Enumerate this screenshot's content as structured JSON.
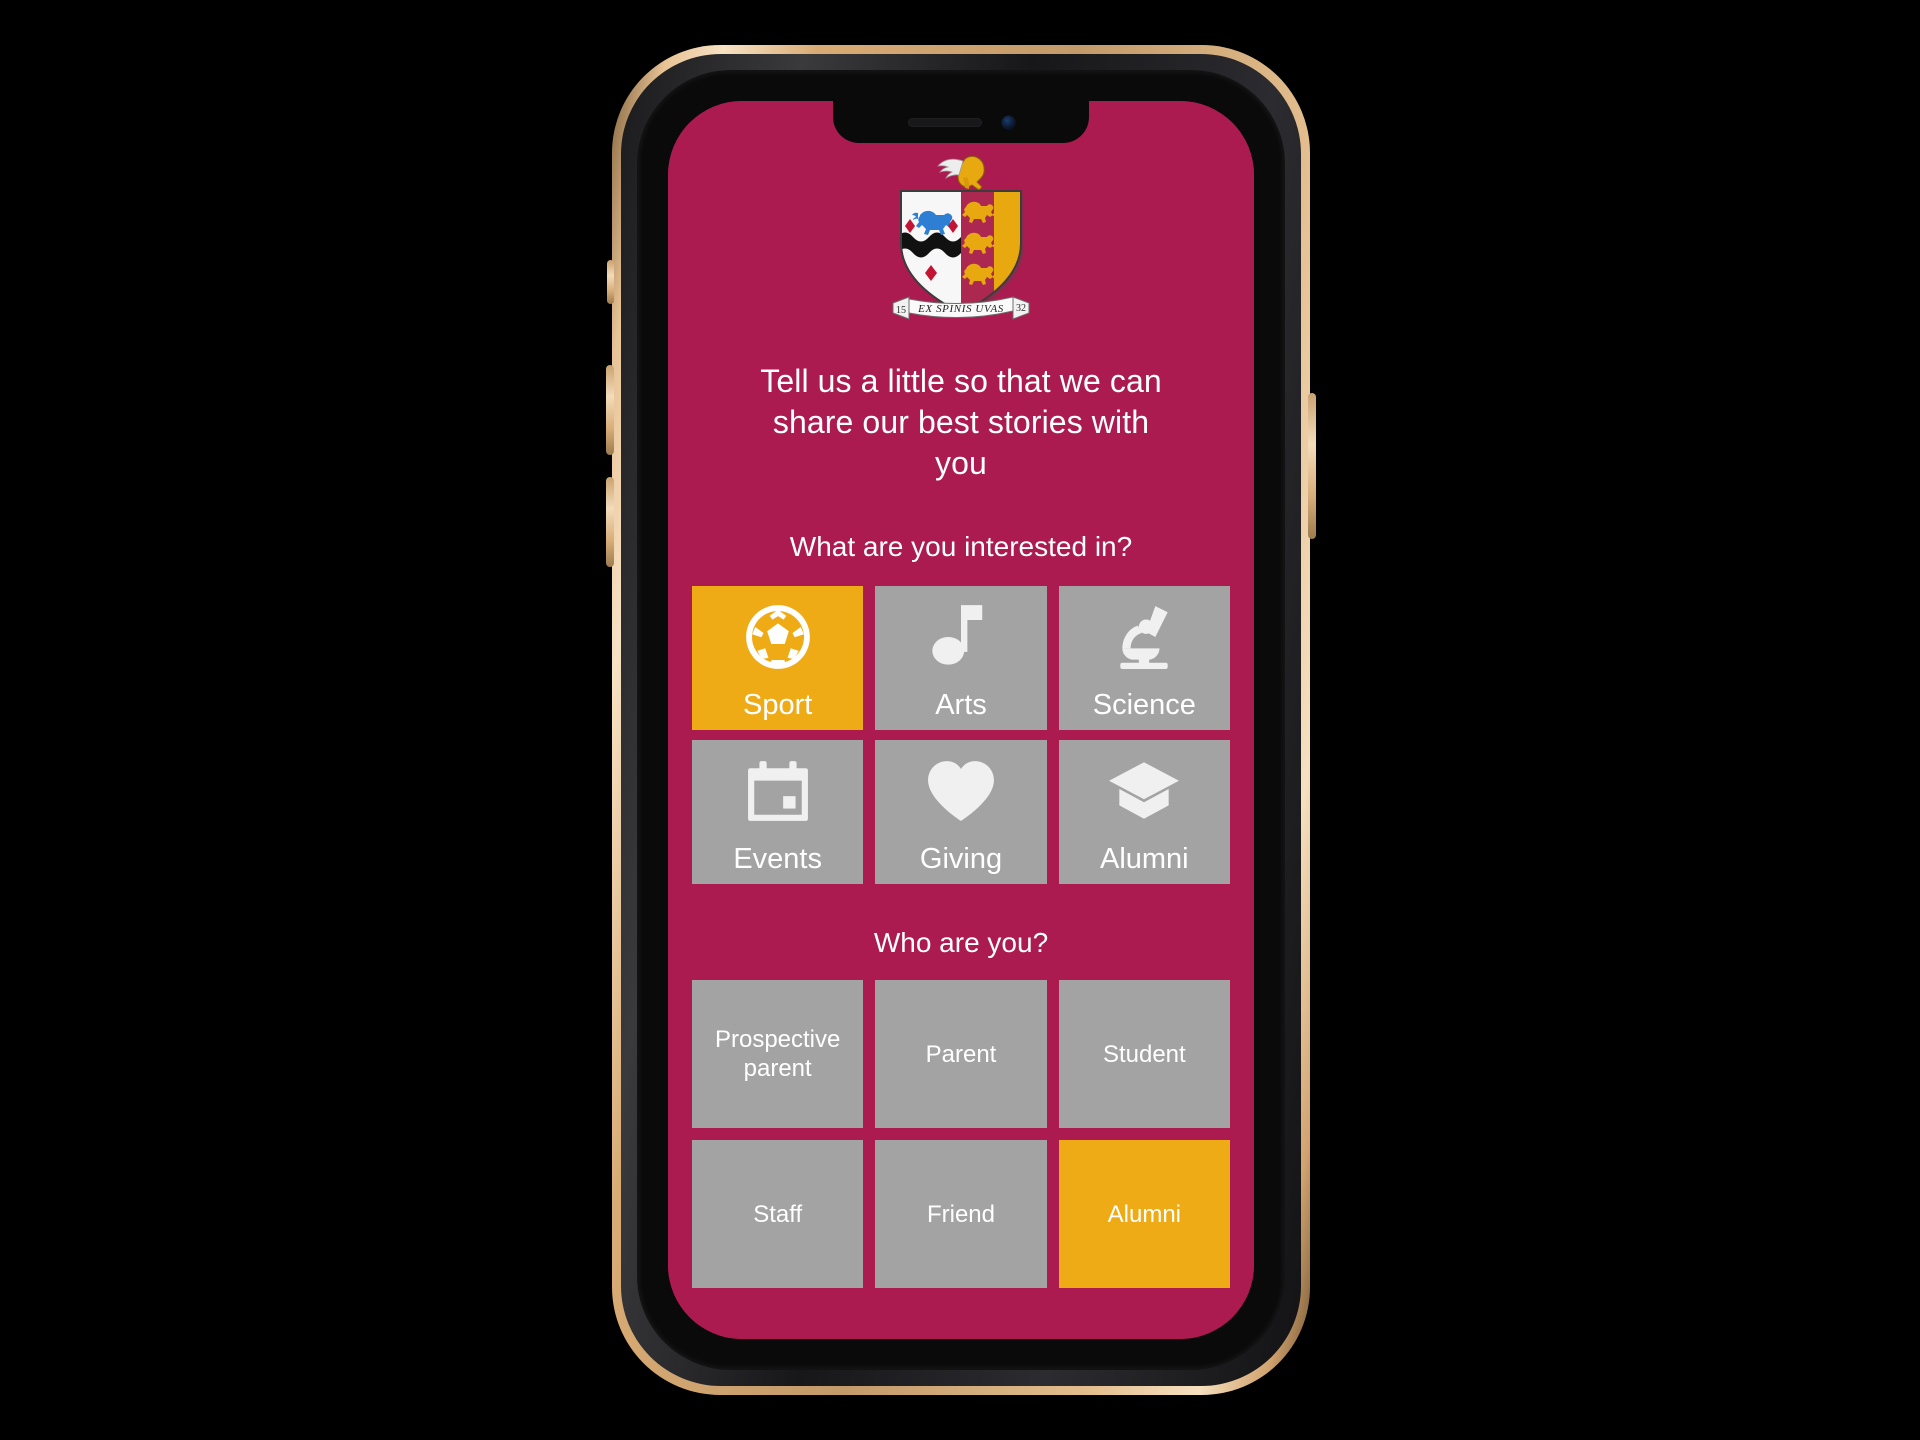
{
  "colors": {
    "brand_maroon": "#AB1B4F",
    "accent_gold": "#EFAB16",
    "tile_grey": "#A3A3A3",
    "text_white": "#FFFFFF",
    "device_gold": "#D9AB74",
    "device_black": "#0A0A0B"
  },
  "crest": {
    "alt": "school-coat-of-arms",
    "motto": "EX SPINIS UVAS",
    "year_left": "15",
    "year_right": "32"
  },
  "headline": "Tell us a little so that we can share our best stories with you",
  "interests": {
    "question": "What are you interested in?",
    "options": [
      {
        "label": "Sport",
        "icon": "football-icon",
        "selected": true
      },
      {
        "label": "Arts",
        "icon": "music-note-icon",
        "selected": false
      },
      {
        "label": "Science",
        "icon": "microscope-icon",
        "selected": false
      },
      {
        "label": "Events",
        "icon": "calendar-icon",
        "selected": false
      },
      {
        "label": "Giving",
        "icon": "heart-icon",
        "selected": false
      },
      {
        "label": "Alumni",
        "icon": "graduation-cap-icon",
        "selected": false
      }
    ]
  },
  "audience": {
    "question": "Who are you?",
    "options": [
      {
        "label": "Prospective parent",
        "selected": false
      },
      {
        "label": "Parent",
        "selected": false
      },
      {
        "label": "Student",
        "selected": false
      },
      {
        "label": "Staff",
        "selected": false
      },
      {
        "label": "Friend",
        "selected": false
      },
      {
        "label": "Alumni",
        "selected": true
      }
    ]
  }
}
